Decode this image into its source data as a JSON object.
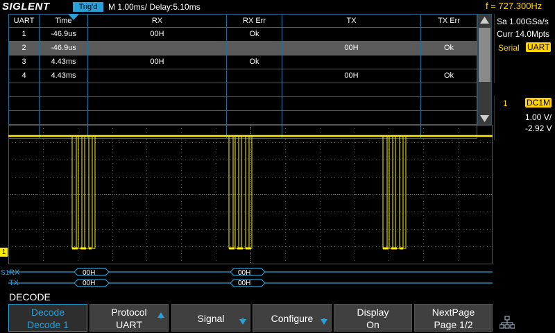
{
  "topbar": {
    "brand": "SIGLENT",
    "trigger_status": "Trig'd",
    "timebase": "M 1.00ms/ Delay:5.10ms",
    "frequency": "f = 727.300Hz"
  },
  "decode_table": {
    "headers": [
      "UART",
      "Time",
      "RX",
      "RX Err",
      "TX",
      "TX Err"
    ],
    "rows": [
      {
        "uart": "1",
        "time": "-46.9us",
        "rx": "00H",
        "rx_err": "Ok",
        "tx": "",
        "tx_err": ""
      },
      {
        "uart": "2",
        "time": "-46.9us",
        "rx": "",
        "rx_err": "",
        "tx": "00H",
        "tx_err": "Ok"
      },
      {
        "uart": "3",
        "time": "4.43ms",
        "rx": "00H",
        "rx_err": "Ok",
        "tx": "",
        "tx_err": ""
      },
      {
        "uart": "4",
        "time": "4.43ms",
        "rx": "",
        "rx_err": "",
        "tx": "00H",
        "tx_err": "Ok"
      }
    ],
    "selected_row": 2
  },
  "right_panel": {
    "sample_rate": "Sa 1.00GSa/s",
    "memory_depth": "Curr 14.0Mpts",
    "serial_label": "Serial",
    "serial_protocol": "UART",
    "channel_number": "1",
    "coupling": "DC1M",
    "volts_per_div": "1.00 V/",
    "offset": "-2.92 V"
  },
  "waveform": {
    "channel_marker": "1",
    "bus_marker": "S1",
    "rx_label": "RX",
    "tx_label": "TX",
    "rx_packets": [
      "00H",
      "00H"
    ],
    "tx_packets": [
      "00H",
      "00H"
    ],
    "colors": {
      "trace": "#ffee00",
      "bus": "#2aa0d8",
      "grid": "#555555"
    }
  },
  "menu": {
    "title": "DECODE",
    "buttons": [
      {
        "line1": "Decode",
        "line2": "Decode 1",
        "icon": ""
      },
      {
        "line1": "Protocol",
        "line2": "UART",
        "icon": "up-arrow-icon"
      },
      {
        "line1": "Signal",
        "line2": "",
        "icon": "down-arrow-icon"
      },
      {
        "line1": "Configure",
        "line2": "",
        "icon": "down-arrow-icon"
      },
      {
        "line1": "Display",
        "line2": "On",
        "icon": ""
      },
      {
        "line1": "NextPage",
        "line2": "Page 1/2",
        "icon": ""
      }
    ],
    "network_icon": "network-icon"
  }
}
